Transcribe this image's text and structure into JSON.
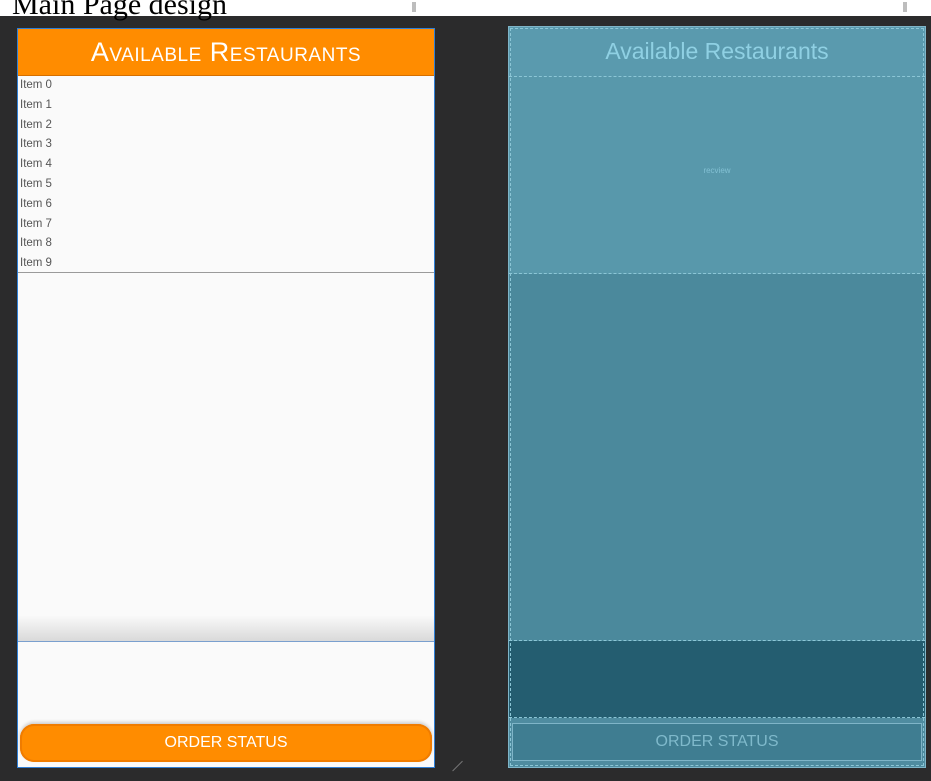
{
  "top_strip": {
    "cut_text": "Main Page design"
  },
  "design_preview": {
    "title": "Available Restaurants",
    "list_items": [
      "Item 0",
      "Item 1",
      "Item 2",
      "Item 3",
      "Item 4",
      "Item 5",
      "Item 6",
      "Item 7",
      "Item 8",
      "Item 9"
    ],
    "order_button_label": "ORDER STATUS"
  },
  "blueprint": {
    "title": "Available Restaurants",
    "recview_label": "recview",
    "order_button_label": "ORDER STATUS"
  },
  "colors": {
    "accent_orange": "#ff8c00",
    "blueprint_bg": "#4f8ca0",
    "selection_blue": "#2f7fd6",
    "canvas_bg": "#2b2b2c"
  }
}
